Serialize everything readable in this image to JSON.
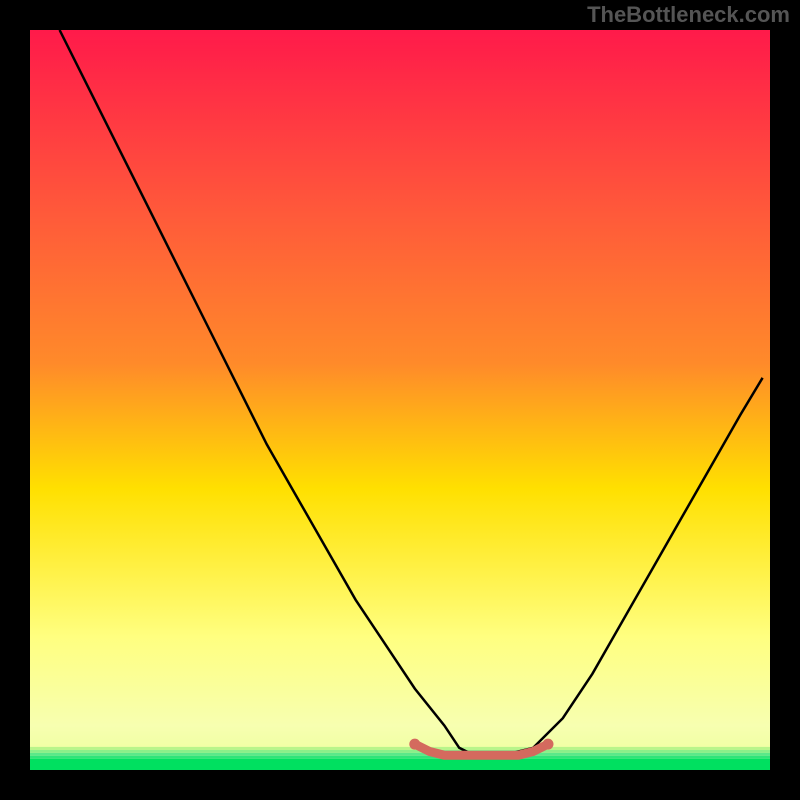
{
  "watermark": "TheBottleneck.com",
  "chart_data": {
    "type": "line",
    "title": "",
    "xlabel": "",
    "ylabel": "",
    "xlim": [
      0,
      100
    ],
    "ylim": [
      0,
      100
    ],
    "background_gradient": {
      "top": "#ff1a4a",
      "mid1": "#ff8a2a",
      "mid2": "#ffe000",
      "mid3": "#ffff80",
      "bottom_band": "#00e060"
    },
    "series": [
      {
        "name": "bottleneck-curve",
        "color": "#000000",
        "x": [
          4,
          8,
          12,
          16,
          20,
          24,
          28,
          32,
          36,
          40,
          44,
          48,
          52,
          56,
          58,
          60,
          64,
          68,
          72,
          76,
          80,
          84,
          88,
          92,
          96,
          99
        ],
        "y": [
          100,
          92,
          84,
          76,
          68,
          60,
          52,
          44,
          37,
          30,
          23,
          17,
          11,
          6,
          3,
          2,
          2,
          3,
          7,
          13,
          20,
          27,
          34,
          41,
          48,
          53
        ]
      },
      {
        "name": "optimal-zone-marker",
        "color": "#d46a5e",
        "x": [
          52,
          54,
          56,
          58,
          60,
          62,
          64,
          66,
          68,
          70
        ],
        "y": [
          3.5,
          2.5,
          2,
          2,
          2,
          2,
          2,
          2,
          2.5,
          3.5
        ]
      }
    ],
    "green_band_y": 1.5
  }
}
